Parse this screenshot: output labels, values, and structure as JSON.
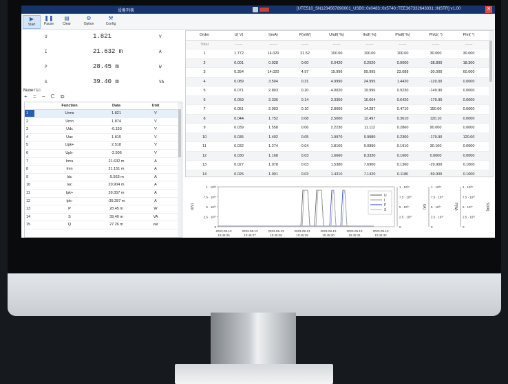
{
  "window": {
    "title": "设备列表",
    "device": "[UTE510_SN1234567890001_USB0::0x0483::0x5740::TEE367332643031::INSTR] v1.00"
  },
  "toolbar": {
    "start": "Start",
    "pause": "Pause",
    "clear": "Clear",
    "option": "Option",
    "config": "Config"
  },
  "meters": [
    {
      "label": "U",
      "value": "1.821",
      "unit": "V"
    },
    {
      "label": "I",
      "value": "21.632 m",
      "unit": "A"
    },
    {
      "label": "P",
      "value": "28.45 m",
      "unit": "W"
    },
    {
      "label": "S",
      "value": "39.40 m",
      "unit": "VA"
    }
  ],
  "numeric": {
    "title": "Numeric",
    "tools": [
      "+",
      "=",
      "−",
      "C",
      "⧉"
    ],
    "headers": [
      "",
      "Function",
      "Data",
      "Unit"
    ],
    "rows": [
      [
        "1",
        "Urms",
        "1.821",
        "V"
      ],
      [
        "2",
        "Umn",
        "1.874",
        "V"
      ],
      [
        "3",
        "Udc",
        "-0.153",
        "V"
      ],
      [
        "4",
        "Uac",
        "1.815",
        "V"
      ],
      [
        "5",
        "Upk+",
        "2.518",
        "V"
      ],
      [
        "6",
        "Upk-",
        "-2.506",
        "V"
      ],
      [
        "7",
        "Irms",
        "21.632 m",
        "A"
      ],
      [
        "8",
        "Imn",
        "21.151 m",
        "A"
      ],
      [
        "9",
        "Idc",
        "-5.563 m",
        "A"
      ],
      [
        "10",
        "Iac",
        "20.904 m",
        "A"
      ],
      [
        "11",
        "Ipk+",
        "39.357 m",
        "A"
      ],
      [
        "12",
        "Ipk-",
        "-39.287 m",
        "A"
      ],
      [
        "13",
        "P",
        "28.45 m",
        "W"
      ],
      [
        "14",
        "S",
        "39.40 m",
        "VA"
      ],
      [
        "15",
        "Q",
        "27.26 m",
        "var"
      ]
    ]
  },
  "harmonics": {
    "headers": [
      "Order",
      "U( V)",
      "I(mA)",
      "P(mW)",
      "Uhdf( %)",
      "Ihdf( %)",
      "Phdf( %)",
      "PhiU( °)",
      "PhiI( °)"
    ],
    "total": [
      "Total",
      "------",
      "------",
      "------",
      "------",
      "------",
      "------",
      "------",
      "------"
    ],
    "rows": [
      [
        "1",
        "1.772",
        "14.020",
        "21.52",
        "100.00",
        "100.00",
        "100.00",
        "30.000",
        "30.000"
      ],
      [
        "2",
        "0.001",
        "0.028",
        "0.00",
        "0.0420",
        "0.2020",
        "0.0000",
        "-38.800",
        "18.300"
      ],
      [
        "3",
        "0.354",
        "14.020",
        "4.97",
        "19.996",
        "99.995",
        "23.088",
        "-30.000",
        "60.000"
      ],
      [
        "4",
        "0.089",
        "3.504",
        "0.31",
        "4.9990",
        "24.995",
        "1.4420",
        "-120.00",
        "0.0000"
      ],
      [
        "5",
        "0.071",
        "2.803",
        "0.20",
        "4.0020",
        "19.996",
        "0.9230",
        "-149.90",
        "0.0000"
      ],
      [
        "6",
        "0.059",
        "2.336",
        "0.14",
        "3.3350",
        "16.664",
        "0.6420",
        "-179.90",
        "0.0000"
      ],
      [
        "7",
        "0.051",
        "2.003",
        "0.10",
        "2.8600",
        "14.287",
        "0.4710",
        "150.00",
        "0.0000"
      ],
      [
        "8",
        "0.044",
        "1.752",
        "0.08",
        "2.5000",
        "12.497",
        "0.3610",
        "120.10",
        "0.0000"
      ],
      [
        "9",
        "0.039",
        "1.558",
        "0.06",
        "2.2230",
        "11.112",
        "0.2860",
        "90.000",
        "0.0000"
      ],
      [
        "10",
        "0.035",
        "1.402",
        "0.05",
        "1.9970",
        "9.9980",
        "0.2300",
        "-179.90",
        "120.00"
      ],
      [
        "11",
        "0.032",
        "1.274",
        "0.04",
        "1.8160",
        "9.0890",
        "0.1910",
        "30.100",
        "0.0000"
      ],
      [
        "12",
        "0.030",
        "1.168",
        "0.03",
        "1.6660",
        "8.3330",
        "0.1600",
        "0.0000",
        "0.0000"
      ],
      [
        "13",
        "0.027",
        "1.078",
        "0.03",
        "1.5380",
        "7.6900",
        "0.1360",
        "-29.900",
        "0.1000"
      ],
      [
        "14",
        "0.025",
        "1.001",
        "0.03",
        "1.4310",
        "7.1420",
        "0.1180",
        "-59.900",
        "0.1000"
      ]
    ]
  },
  "chart_data": {
    "type": "line",
    "ylabel_left": "U(V)",
    "ylabel_right": [
      "I(A)",
      "P(W)",
      "S(VA)"
    ],
    "yticks": [
      "0",
      "2.5 · 10³⁷",
      "5 · 10³⁷",
      "7.5 · 10³⁷",
      "1 · 10³⁸"
    ],
    "x": [
      "2023-09-13\n10:45:26",
      "2023-09-13\n10:45:27",
      "2023-09-13\n10:45:28",
      "2023-09-13\n10:45:29",
      "2023-09-13\n10:45:30",
      "2023-09-13\n10:45:31",
      "2023-09-13\n10:45:32"
    ],
    "legend": [
      "U",
      "I",
      "P",
      "S"
    ],
    "series_colors": {
      "U": "#555555",
      "I": "#999999",
      "P": "#2a3fcf",
      "S": "#b0b0b0"
    },
    "pulse_bursts_start_time": "10:45:29"
  }
}
